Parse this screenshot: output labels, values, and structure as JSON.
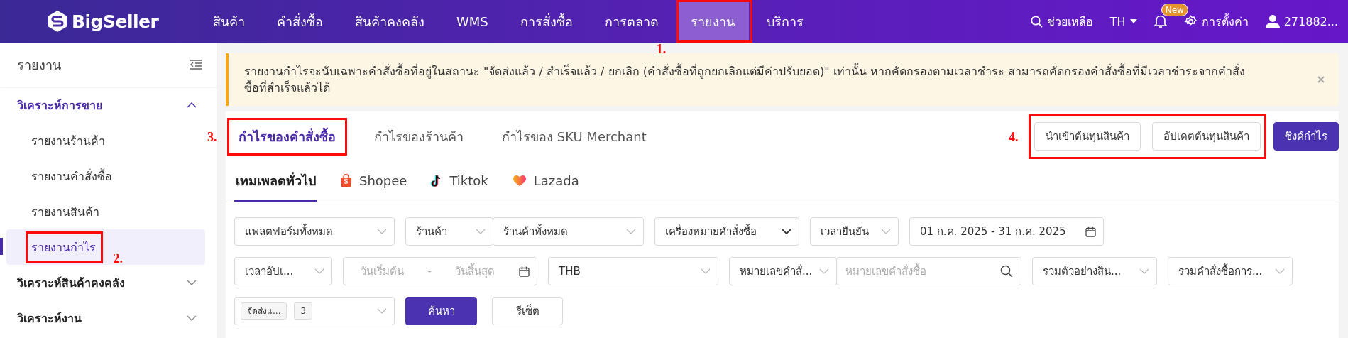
{
  "app": {
    "logo": "BigSeller"
  },
  "nav": [
    {
      "label": "สินค้า",
      "selected": false
    },
    {
      "label": "คำสั่งซื้อ",
      "selected": false
    },
    {
      "label": "สินค้าคงคลัง",
      "selected": false
    },
    {
      "label": "WMS",
      "selected": false
    },
    {
      "label": "การสั่งซื้อ",
      "selected": false
    },
    {
      "label": "การตลาด",
      "selected": false
    },
    {
      "label": "รายงาน",
      "selected": true,
      "annotation": "1."
    },
    {
      "label": "บริการ",
      "selected": false
    }
  ],
  "header_tools": {
    "help": "ช่วยเหลือ",
    "language": "TH",
    "badge": "New",
    "settings": "การตั้งค่า",
    "user": "271882..."
  },
  "sidebar": {
    "title": "รายงาน",
    "sections": [
      {
        "label": "วิเคราะห์การขาย",
        "selected": true,
        "expanded": true,
        "children": [
          {
            "label": "รายงานร้านค้า",
            "selected": false
          },
          {
            "label": "รายงานคำสั่งซื้อ",
            "selected": false
          },
          {
            "label": "รายงานสินค้า",
            "selected": false
          },
          {
            "label": "รายงานกำไร",
            "selected": true,
            "annotation": "2."
          }
        ]
      },
      {
        "label": "วิเคราะห์สินค้าคงคลัง",
        "selected": false,
        "expanded": false
      },
      {
        "label": "วิเคราะห์งาน",
        "selected": false,
        "expanded": false
      }
    ]
  },
  "notice": {
    "text": "รายงานกำไรจะนับเฉพาะคำสั่งซื้อที่อยู่ในสถานะ \"จัดส่งแล้ว / สำเร็จแล้ว / ยกเลิก (คำสั่งซื้อที่ถูกยกเลิกแต่มีค่าปรับยอด)\" เท่านั้น หากคัดกรองตามเวลาชำระ สามารถคัดกรองคำสั่งซื้อที่มีเวลาชำระจากคำสั่งซื้อที่สำเร็จแล้วได้"
  },
  "report_tabs": [
    {
      "label": "กำไรของคำสั่งซื้อ",
      "selected": true,
      "annotation": "3."
    },
    {
      "label": "กำไรของร้านค้า",
      "selected": false
    },
    {
      "label": "กำไรของ SKU Merchant",
      "selected": false
    }
  ],
  "actions": {
    "group": {
      "annotation": "4.",
      "buttons": [
        "นำเข้าต้นทุนสินค้า",
        "อัปเดตต้นทุนสินค้า"
      ]
    },
    "primary": "ซิงค์กำไร"
  },
  "platform_tabs": [
    {
      "label": "เทมเพลตทั่วไป",
      "selected": true,
      "kind": "general"
    },
    {
      "label": "Shopee",
      "selected": false,
      "kind": "shopee"
    },
    {
      "label": "Tiktok",
      "selected": false,
      "kind": "tiktok"
    },
    {
      "label": "Lazada",
      "selected": false,
      "kind": "lazada"
    }
  ],
  "filters": [
    [
      {
        "kind": "select",
        "value": "แพลตฟอร์มทั้งหมด"
      },
      {
        "kind": "combo",
        "parts": [
          {
            "kind": "select",
            "value": "ร้านค้า"
          },
          {
            "kind": "select",
            "value": "ร้านค้าทั้งหมด"
          }
        ]
      },
      {
        "kind": "select",
        "value": "เครื่องหมายคำสั่งซื้อ",
        "strong": true
      },
      {
        "kind": "select",
        "value": "เวลายืนยัน"
      },
      {
        "kind": "date",
        "value": "01 ก.ค. 2025 - 31 ก.ค. 2025"
      }
    ],
    [
      {
        "kind": "select",
        "value": "เวลาอัปเ..."
      },
      {
        "kind": "date_range",
        "start_placeholder": "วันเริ่มต้น",
        "separator": "-",
        "end_placeholder": "วันสิ้นสุด"
      },
      {
        "kind": "select",
        "value": "THB"
      },
      {
        "kind": "combo",
        "parts": [
          {
            "kind": "select",
            "value": "หมายเลขคำสั่..."
          },
          {
            "kind": "search",
            "placeholder": "หมายเลขคำสั่งซื้อ"
          }
        ]
      },
      {
        "kind": "select",
        "value": "รวมตัวอย่างสิน..."
      },
      {
        "kind": "select",
        "value": "รวมคำสั่งซื้อการ..."
      }
    ],
    [
      {
        "kind": "tags",
        "tag": "จัดส่งแ...",
        "count": "3"
      },
      {
        "kind": "button",
        "label": "ค้นหา",
        "primary": true
      },
      {
        "kind": "button",
        "label": "รีเซ็ต",
        "primary": false
      }
    ]
  ]
}
